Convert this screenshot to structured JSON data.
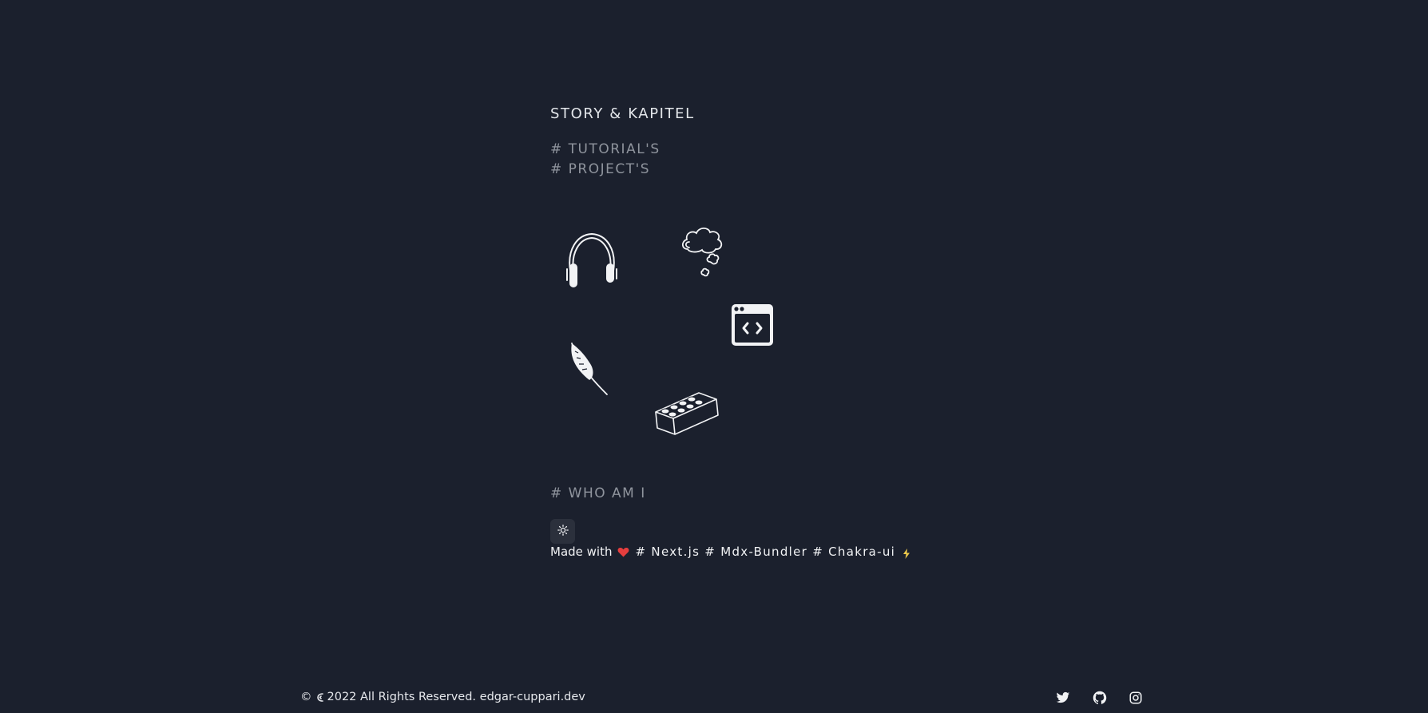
{
  "header": {
    "title": "STORY & KAPITEL"
  },
  "nav": {
    "tutorials": "# TUTORIAL'S",
    "projects": "# PROJECT'S",
    "who_am_i": "# WHO AM I"
  },
  "doodles": {
    "icons": [
      "headphones-icon",
      "thought-cloud-icon",
      "browser-code-icon",
      "feather-icon",
      "lego-brick-icon"
    ]
  },
  "footer_credits": {
    "made_with": "Made with",
    "tech": "# Next.js # Mdx-Bundler # Chakra-ui",
    "heart_color": "#e53e3e",
    "bolt_color": "#ecc94b"
  },
  "theme_toggle": {
    "icon": "sun-icon"
  },
  "footer": {
    "copyright_prefix": "©",
    "copyright_text": "2022 All Rights Reserved. edgar-cuppari.dev",
    "social": [
      "twitter-icon",
      "github-icon",
      "instagram-icon"
    ]
  },
  "colors": {
    "background": "#1b202d",
    "text": "#e6e8ec",
    "muted": "#8f949d"
  }
}
